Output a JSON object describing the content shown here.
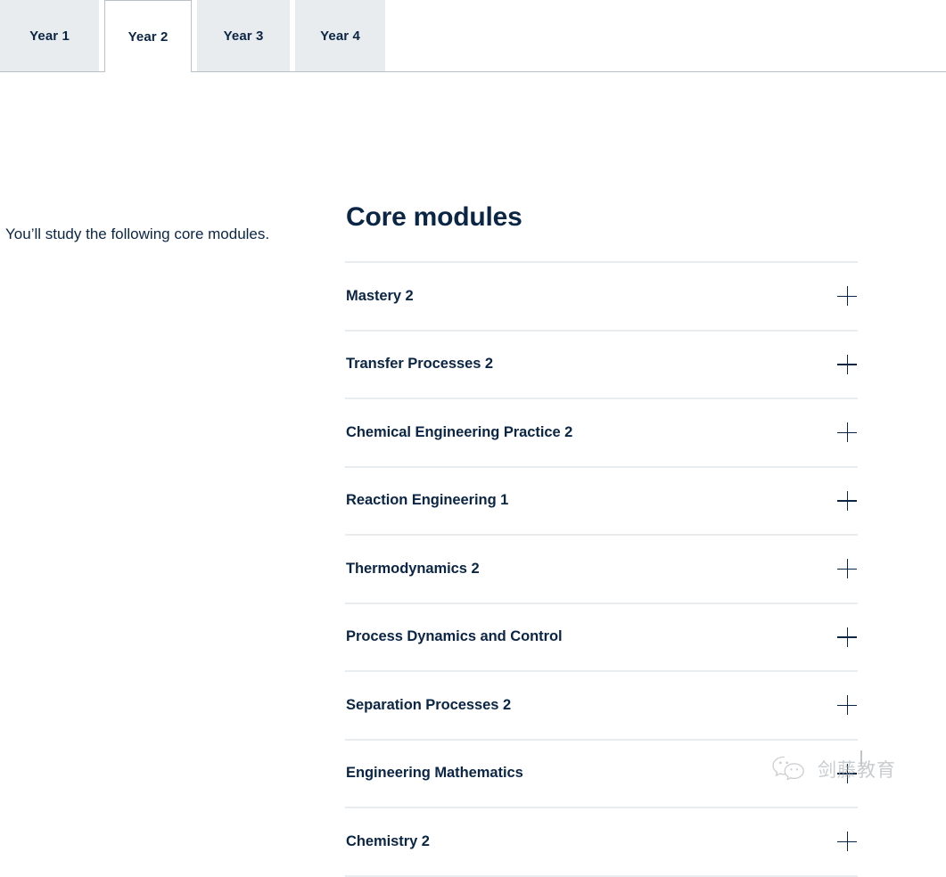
{
  "tabs": {
    "items": [
      {
        "label": "Year 1",
        "active": false
      },
      {
        "label": "Year 2",
        "active": true
      },
      {
        "label": "Year 3",
        "active": false
      },
      {
        "label": "Year 4",
        "active": false
      }
    ]
  },
  "intro": {
    "text": "You’ll study the following core modules."
  },
  "main": {
    "section_title": "Core modules",
    "modules": [
      {
        "title": "Mastery 2",
        "toggle": "plus-icon"
      },
      {
        "title": "Transfer Processes 2",
        "toggle": "plus-icon"
      },
      {
        "title": "Chemical Engineering Practice 2",
        "toggle": "plus-icon"
      },
      {
        "title": "Reaction Engineering 1",
        "toggle": "plus-icon"
      },
      {
        "title": "Thermodynamics 2",
        "toggle": "plus-icon"
      },
      {
        "title": "Process Dynamics and Control",
        "toggle": "plus-icon"
      },
      {
        "title": "Separation Processes 2",
        "toggle": "plus-icon"
      },
      {
        "title": "Engineering Mathematics",
        "toggle": "plus-icon"
      },
      {
        "title": "Chemistry 2",
        "toggle": "plus-icon"
      }
    ]
  },
  "watermark": {
    "icon": "wechat-icon",
    "text": "剑藤教育"
  },
  "colors": {
    "navy": "#0b2545",
    "tab_inactive_bg": "#e8ecee",
    "divider": "#e8ecee",
    "tab_border": "#b9c0c7",
    "watermark_text": "#a9adb2"
  }
}
